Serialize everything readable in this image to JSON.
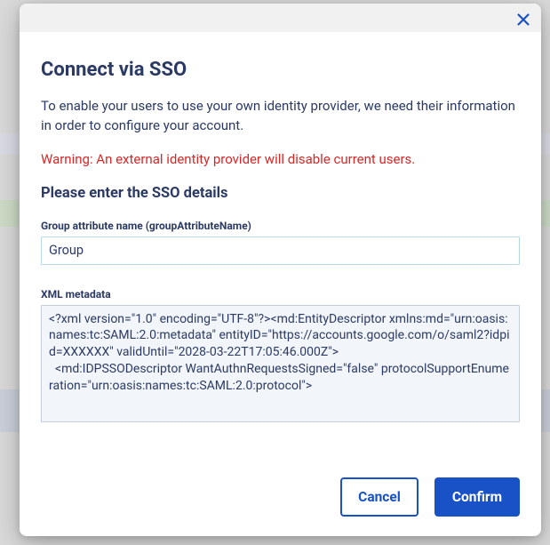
{
  "modal": {
    "title": "Connect via SSO",
    "intro": "To enable your users to use your own identity provider, we need their information in order to configure your account.",
    "warning": "Warning: An external identity provider will disable current users.",
    "subheading": "Please enter the SSO details"
  },
  "fields": {
    "group_attribute": {
      "label": "Group attribute name (groupAttributeName)",
      "value": "Group"
    },
    "xml_metadata": {
      "label": "XML metadata",
      "value": "<?xml version=\"1.0\" encoding=\"UTF-8\"?><md:EntityDescriptor xmlns:md=\"urn:oasis:names:tc:SAML:2.0:metadata\" entityID=\"https://accounts.google.com/o/saml2?idpid=XXXXXX\" validUntil=\"2028-03-22T17:05:46.000Z\">\n  <md:IDPSSODescriptor WantAuthnRequestsSigned=\"false\" protocolSupportEnumeration=\"urn:oasis:names:tc:SAML:2.0:protocol\">"
    }
  },
  "buttons": {
    "cancel": "Cancel",
    "confirm": "Confirm"
  }
}
